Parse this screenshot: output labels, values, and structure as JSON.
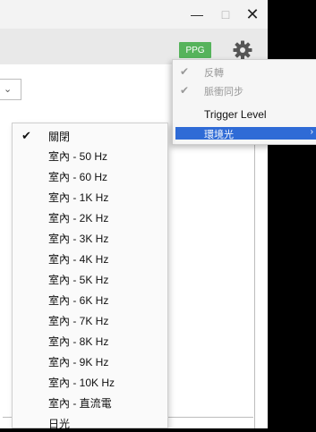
{
  "window_controls": {
    "minimize": "—",
    "maximize": "□",
    "close": "✕"
  },
  "toolbar": {
    "ppg_label": "PPG",
    "settings_icon": "gear-icon",
    "accent": "#56b35b"
  },
  "combo": {
    "arrow": "⌄"
  },
  "menu": {
    "items": [
      {
        "label": "反轉",
        "checked": true,
        "enabled": false
      },
      {
        "label": "脈衝同步",
        "checked": true,
        "enabled": false
      },
      {
        "label": "Trigger Level",
        "checked": false,
        "enabled": true
      },
      {
        "label": "環境光",
        "checked": false,
        "enabled": true,
        "selected": true,
        "submenu_arrow": "›"
      }
    ],
    "check_glyph": "✔",
    "highlight_color": "#2f6bd6"
  },
  "submenu": {
    "items": [
      {
        "label": "關閉",
        "checked": true
      },
      {
        "label": "室內 - 50 Hz",
        "checked": false
      },
      {
        "label": "室內 - 60 Hz",
        "checked": false
      },
      {
        "label": "室內 - 1K Hz",
        "checked": false
      },
      {
        "label": "室內 - 2K Hz",
        "checked": false
      },
      {
        "label": "室內 - 3K Hz",
        "checked": false
      },
      {
        "label": "室內 - 4K Hz",
        "checked": false
      },
      {
        "label": "室內 - 5K Hz",
        "checked": false
      },
      {
        "label": "室內 - 6K Hz",
        "checked": false
      },
      {
        "label": "室內 - 7K Hz",
        "checked": false
      },
      {
        "label": "室內 - 8K Hz",
        "checked": false
      },
      {
        "label": "室內 - 9K Hz",
        "checked": false
      },
      {
        "label": "室內 - 10K Hz",
        "checked": false
      },
      {
        "label": "室內 - 直流電",
        "checked": false
      },
      {
        "label": "日光",
        "checked": false
      }
    ],
    "check_glyph": "✔"
  }
}
